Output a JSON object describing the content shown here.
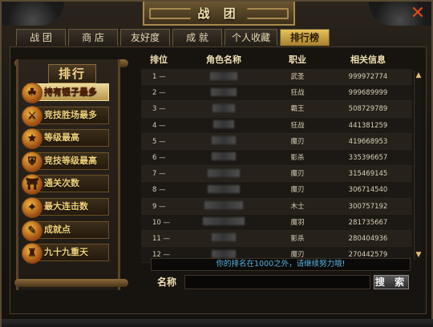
{
  "window": {
    "title": "战 团",
    "close_glyph": "✕"
  },
  "tabs": [
    {
      "label": "战 团",
      "active": false
    },
    {
      "label": "商 店",
      "active": false
    },
    {
      "label": "友好度",
      "active": false
    },
    {
      "label": "成 就",
      "active": false
    },
    {
      "label": "个人收藏",
      "active": false
    },
    {
      "label": "排行榜",
      "active": true
    }
  ],
  "sidebar": {
    "title": "排行",
    "items": [
      {
        "label": "持有银子最多",
        "icon": "coin-icon",
        "glyph": "☘",
        "active": true
      },
      {
        "label": "竞技胜场最多",
        "icon": "sword-icon",
        "glyph": "⚔",
        "active": false
      },
      {
        "label": "等级最高",
        "icon": "level-icon",
        "glyph": "★",
        "active": false
      },
      {
        "label": "竞技等级最高",
        "icon": "shield-icon",
        "glyph": "⛨",
        "active": false
      },
      {
        "label": "通关次数",
        "icon": "gate-icon",
        "glyph": "⛩",
        "active": false
      },
      {
        "label": "最大连击数",
        "icon": "combo-icon",
        "glyph": "✦",
        "active": false
      },
      {
        "label": "成就点",
        "icon": "scroll-icon",
        "glyph": "✎",
        "active": false
      },
      {
        "label": "九十九重天",
        "icon": "tower-icon",
        "glyph": "♜",
        "active": false
      }
    ]
  },
  "table": {
    "headers": [
      "排位",
      "角色名称",
      "职业",
      "相关信息"
    ],
    "rows": [
      {
        "rank": "1 —",
        "class": "武圣",
        "info": "999972774",
        "name_w": 34
      },
      {
        "rank": "2 —",
        "class": "狂战",
        "info": "999689999",
        "name_w": 32
      },
      {
        "rank": "3 —",
        "class": "霸王",
        "info": "508729789",
        "name_w": 28
      },
      {
        "rank": "4 —",
        "class": "狂战",
        "info": "441381259",
        "name_w": 26
      },
      {
        "rank": "5 —",
        "class": "魔刃",
        "info": "419668953",
        "name_w": 30
      },
      {
        "rank": "6 —",
        "class": "影杀",
        "info": "335396657",
        "name_w": 30
      },
      {
        "rank": "7 —",
        "class": "魔刃",
        "info": "315469145",
        "name_w": 40
      },
      {
        "rank": "8 —",
        "class": "魔刃",
        "info": "306714540",
        "name_w": 40
      },
      {
        "rank": "9 —",
        "class": "木士",
        "info": "300757192",
        "name_w": 48
      },
      {
        "rank": "10 —",
        "class": "魔羽",
        "info": "281735667",
        "name_w": 52
      },
      {
        "rank": "11 —",
        "class": "影杀",
        "info": "280404936",
        "name_w": 30
      },
      {
        "rank": "12 —",
        "class": "魔刃",
        "info": "270442579",
        "name_w": 30
      }
    ]
  },
  "notice": "你的排名在1000之外，请继续努力哦!",
  "search": {
    "label": "名称",
    "value": "",
    "placeholder": "",
    "button_label": "搜 索"
  }
}
